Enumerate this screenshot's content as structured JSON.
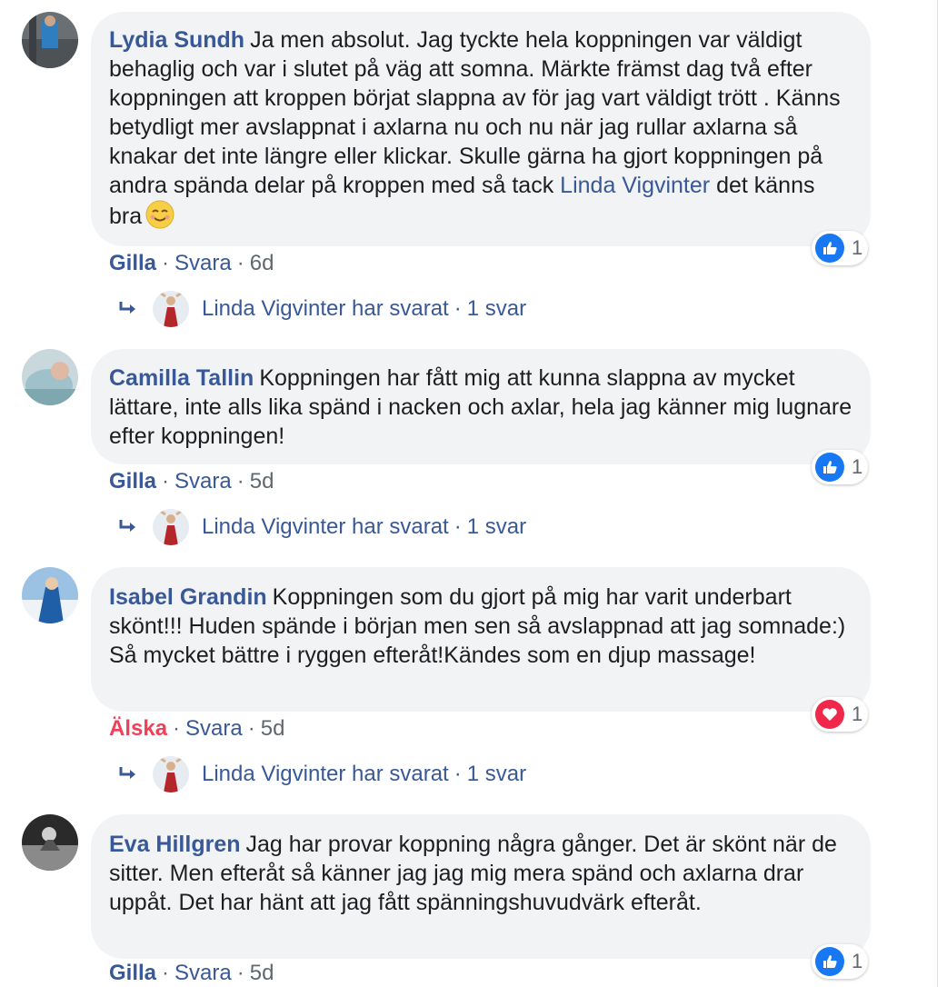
{
  "comments": [
    {
      "author": "Lydia Sundh",
      "text_before": "Ja men absolut. Jag tyckte hela koppningen var väldigt behaglig och var i slutet på väg att somna. Märkte främst dag två efter koppningen att kroppen börjat slappna av för jag vart väldigt trött . Känns betydligt mer avslappnat i axlarna nu och nu när jag rullar axlarna så knakar det inte längre eller klickar. Skulle gärna ha gjort koppningen på andra spända delar på kroppen med så tack",
      "mention": "Linda Vigvinter",
      "text_after": "det känns bra",
      "emoji": "smiling-face-emoji",
      "reaction": "like",
      "reaction_count": "1",
      "action": "Gilla",
      "reply_label": "Svara",
      "time": "6d",
      "replies": {
        "name": "Linda Vigvinter",
        "text": "har svarat",
        "count": "1 svar"
      }
    },
    {
      "author": "Camilla Tallin",
      "text_before": "Koppningen har fått mig att kunna slappna av mycket lättare, inte alls lika spänd i nacken och axlar, hela jag känner mig lugnare efter koppningen!",
      "reaction": "like",
      "reaction_count": "1",
      "action": "Gilla",
      "reply_label": "Svara",
      "time": "5d",
      "replies": {
        "name": "Linda Vigvinter",
        "text": "har svarat",
        "count": "1 svar"
      }
    },
    {
      "author": "Isabel Grandin",
      "text_before": "Koppningen som du gjort på mig har varit underbart skönt!!! Huden spände i början men sen så avslappnad att jag somnade:) Så mycket bättre i ryggen efteråt!Kändes som en djup massage!",
      "reaction": "love",
      "reaction_count": "1",
      "action": "Älska",
      "reply_label": "Svara",
      "time": "5d",
      "replies": {
        "name": "Linda Vigvinter",
        "text": "har svarat",
        "count": "1 svar"
      }
    },
    {
      "author": "Eva Hillgren",
      "text_before": "Jag har provar koppning några gånger. Det är skönt när de sitter. Men efteråt så känner jag jag mig mera spänd och axlarna drar uppåt. Det har hänt att jag fått spänningshuvudvärk efteråt.",
      "reaction": "like",
      "reaction_count": "1",
      "action": "Gilla",
      "reply_label": "Svara",
      "time": "5d"
    }
  ],
  "colors": {
    "name_link": "#385898",
    "bubble_bg": "#f2f3f5",
    "like_blue": "#1877f2",
    "love_red": "#f0284a",
    "meta_gray": "#606770"
  },
  "icons": [
    "thumbs-up-icon",
    "heart-icon",
    "reply-arrow-icon",
    "smiling-face-emoji"
  ]
}
